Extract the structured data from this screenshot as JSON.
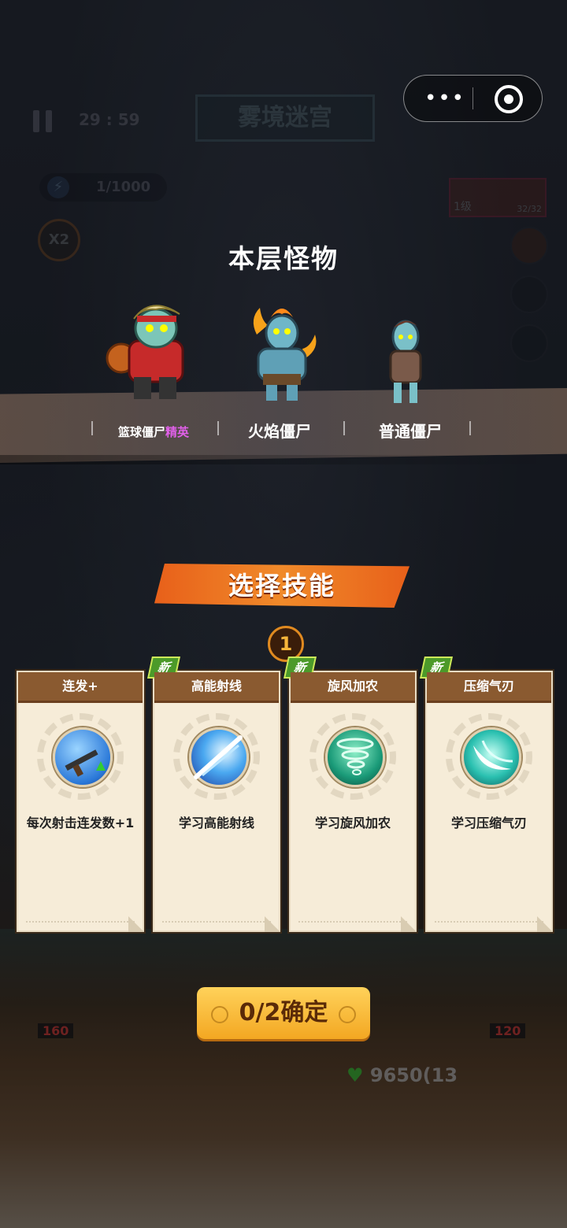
{
  "game": {
    "timer": "29 : 59",
    "stage_title": "雾境迷宫",
    "energy": "1/1000",
    "speed": "X2",
    "weapon_level": "1级",
    "weapon_ammo": "32/32"
  },
  "monsters": {
    "title": "本层怪物",
    "items": [
      {
        "name": "篮球僵尸",
        "tag": "精英"
      },
      {
        "name": "火焰僵尸"
      },
      {
        "name": "普通僵尸"
      }
    ]
  },
  "skills": {
    "title": "选择技能",
    "selected_count": "1",
    "new_label": "新",
    "cards": [
      {
        "title": "连发+",
        "desc": "每次射击连发数+1",
        "is_new": false,
        "icon": "rifle-icon"
      },
      {
        "title": "高能射线",
        "desc": "学习高能射线",
        "is_new": true,
        "icon": "beam-icon"
      },
      {
        "title": "旋风加农",
        "desc": "学习旋风加农",
        "is_new": true,
        "icon": "tornado-icon"
      },
      {
        "title": "压缩气刃",
        "desc": "学习压缩气刃",
        "is_new": true,
        "icon": "air-blade-icon"
      }
    ]
  },
  "confirm_label": "0/2确定",
  "hud_bottom": {
    "hp": "9650(13",
    "cost_left": "160",
    "cost_right": "120"
  },
  "colors": {
    "accent_orange": "#f08a2a",
    "elite_purple": "#e060e8",
    "new_green": "#4c9a2a"
  }
}
